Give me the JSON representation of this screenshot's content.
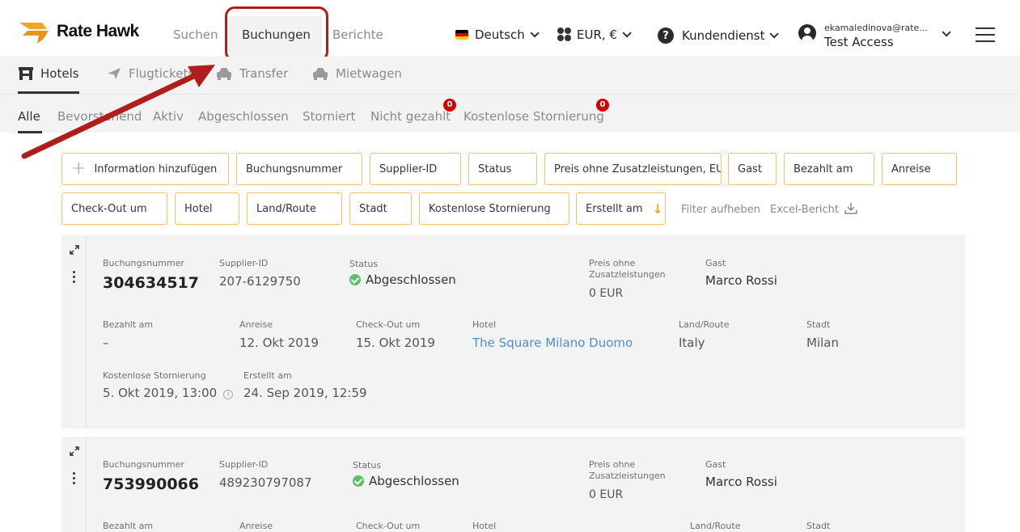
{
  "header": {
    "brand": "Rate Hawk",
    "nav": [
      "Suchen",
      "Buchungen",
      "Berichte"
    ],
    "language": "Deutsch",
    "currency": "EUR, €",
    "support": "Kundendienst",
    "user_email": "ekamaledinova@rate...",
    "user_name": "Test Access"
  },
  "product_tabs": [
    {
      "label": "Hotels",
      "icon": "hotel-icon"
    },
    {
      "label": "Flugtickets",
      "icon": "airplane-icon"
    },
    {
      "label": "Transfer",
      "icon": "car-icon"
    },
    {
      "label": "Mietwagen",
      "icon": "car-icon"
    }
  ],
  "status_tabs": [
    "Alle",
    "Bevorstehend",
    "Aktiv",
    "Abgeschlossen",
    "Storniert",
    "Nicht gezahlt",
    "Kostenlose Stornierung"
  ],
  "badges": {
    "nicht_gezahlt": "0",
    "kostenlose_stornierung": "0"
  },
  "filters": {
    "row1": [
      "Information hinzufügen",
      "Buchungsnummer",
      "Supplier-ID",
      "Status",
      "Preis ohne Zusatzleistungen, EUR",
      "Gast",
      "Bezahlt am",
      "Anreise"
    ],
    "row2": [
      "Check-Out um",
      "Hotel",
      "Land/Route",
      "Stadt",
      "Kostenlose Stornierung",
      "Erstellt am"
    ],
    "clear": "Filter aufheben",
    "excel": "Excel-Bericht"
  },
  "labels": {
    "booking_number": "Buchungsnummer",
    "supplier_id": "Supplier-ID",
    "status": "Status",
    "price_line1": "Preis ohne",
    "price_line2": "Zusatzleistungen",
    "guest": "Gast",
    "paid_at": "Bezahlt am",
    "arrival": "Anreise",
    "checkout": "Check-Out um",
    "hotel": "Hotel",
    "country": "Land/Route",
    "city": "Stadt",
    "free_cancel": "Kostenlose Stornierung",
    "created": "Erstellt am"
  },
  "bookings": [
    {
      "number": "304634517",
      "supplier_id": "207-6129750",
      "status": "Abgeschlossen",
      "price": "0 EUR",
      "guest": "Marco Rossi",
      "paid_at": "–",
      "arrival": "12. Okt 2019",
      "checkout": "15. Okt 2019",
      "hotel": "The Square Milano Duomo",
      "country": "Italy",
      "city": "Milan",
      "free_cancel": "5. Okt 2019, 13:00",
      "created": "24. Sep 2019, 12:59"
    },
    {
      "number": "753990066",
      "supplier_id": "489230797087",
      "status": "Abgeschlossen",
      "price": "0 EUR",
      "guest": "Marco Rossi"
    }
  ],
  "colors": {
    "accent": "#f0a823",
    "annotation": "#b01d1d",
    "link": "#4a8fd9",
    "badge": "#d40000"
  }
}
